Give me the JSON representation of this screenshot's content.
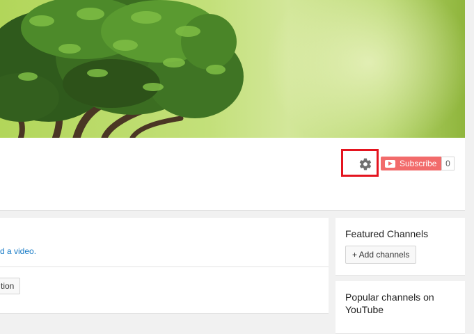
{
  "channel_header": {
    "subscribe_label": "Subscribe",
    "subscriber_count": "0"
  },
  "main_section": {
    "link_text": "d a video.",
    "button_label": "tion"
  },
  "sidebar": {
    "featured_title": "Featured Channels",
    "add_channels_label": "+ Add channels",
    "popular_title": "Popular channels on YouTube"
  },
  "icons": {
    "settings": "gear-icon",
    "subscribe_logo": "youtube-play-icon"
  },
  "colors": {
    "subscribe_bg": "#f26b6b",
    "highlight": "#e4141f",
    "link": "#167ac6",
    "banner_green": "#b2d65a"
  }
}
